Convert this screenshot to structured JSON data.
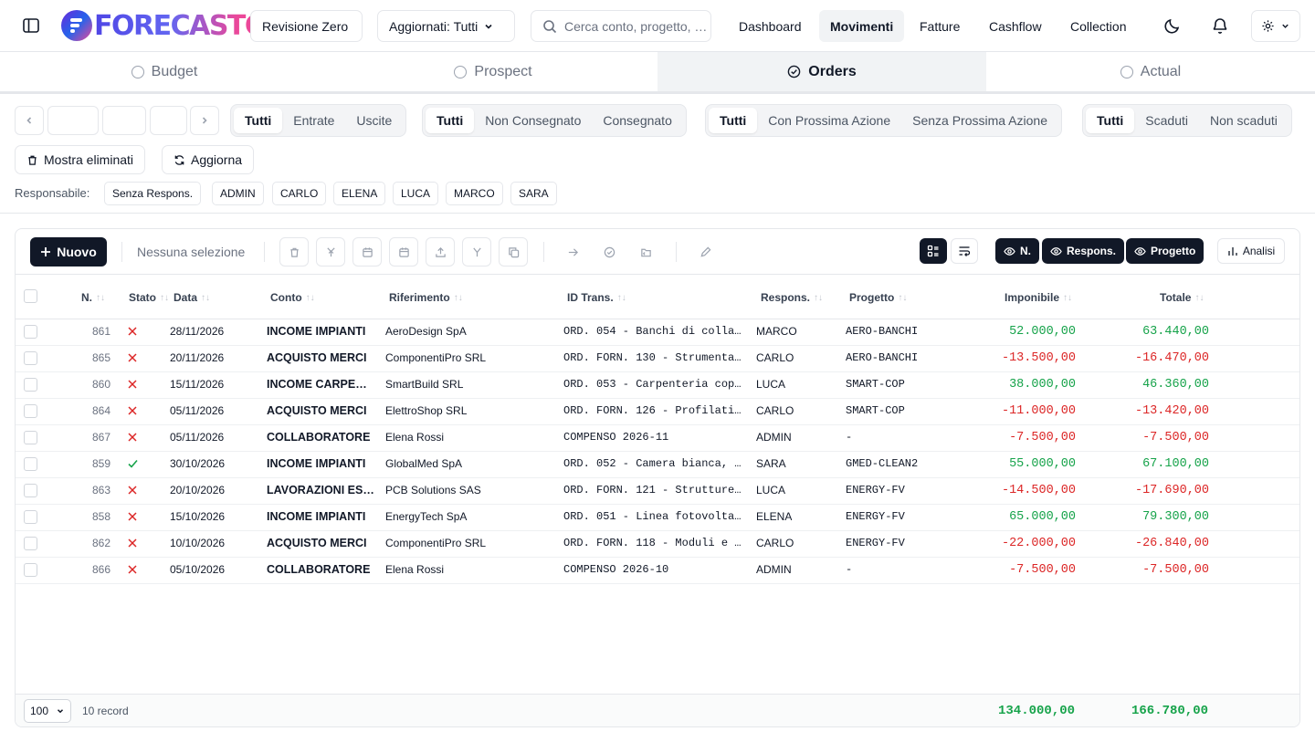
{
  "header": {
    "logo_text": "FORECASTC",
    "scenario_label": "Revisione Zero",
    "updated_label": "Aggiornati: Tutti",
    "search_placeholder": "Cerca conto, progetto, …",
    "nav": [
      "Dashboard",
      "Movimenti",
      "Fatture",
      "Cashflow",
      "Collection"
    ],
    "active_nav": "Movimenti"
  },
  "scenario_tabs": [
    {
      "label": "Budget",
      "active": false
    },
    {
      "label": "Prospect",
      "active": false
    },
    {
      "label": "Orders",
      "active": true
    },
    {
      "label": "Actual",
      "active": false
    }
  ],
  "filters": {
    "direction": [
      "Tutti",
      "Entrate",
      "Uscite"
    ],
    "delivery": [
      "Tutti",
      "Non Consegnato",
      "Consegnato"
    ],
    "next_action": [
      "Tutti",
      "Con Prossima Azione",
      "Senza Prossima Azione"
    ],
    "due": [
      "Tutti",
      "Scaduti",
      "Non scaduti"
    ]
  },
  "actions": {
    "show_deleted": "Mostra eliminati",
    "refresh": "Aggiorna"
  },
  "responsabile": {
    "label": "Responsabile:",
    "chips": [
      "Senza Respons.",
      "ADMIN",
      "CARLO",
      "ELENA",
      "LUCA",
      "MARCO",
      "SARA"
    ]
  },
  "toolbar": {
    "new_label": "Nuovo",
    "selection_text": "Nessuna selezione",
    "toggles": [
      "N.",
      "Respons.",
      "Progetto"
    ],
    "analysis_label": "Analisi"
  },
  "table": {
    "columns": [
      "N.",
      "Stato",
      "Data",
      "Conto",
      "Riferimento",
      "ID Trans.",
      "Respons.",
      "Progetto",
      "Imponibile",
      "Totale"
    ],
    "rows": [
      {
        "n": "861",
        "ok": false,
        "data": "28/11/2026",
        "conto": "INCOME IMPIANTI",
        "rif": "AeroDesign SpA",
        "id": "ORD. 054 - Banchi di colla…",
        "resp": "MARCO",
        "prog": "AERO-BANCHI",
        "imp": "52.000,00",
        "tot": "63.440,00",
        "sign": "pos"
      },
      {
        "n": "865",
        "ok": false,
        "data": "20/11/2026",
        "conto": "ACQUISTO MERCI",
        "rif": "ComponentiPro SRL",
        "id": "ORD. FORN. 130 - Strumenta…",
        "resp": "CARLO",
        "prog": "AERO-BANCHI",
        "imp": "-13.500,00",
        "tot": "-16.470,00",
        "sign": "neg"
      },
      {
        "n": "860",
        "ok": false,
        "data": "15/11/2026",
        "conto": "INCOME CARPENT…",
        "rif": "SmartBuild SRL",
        "id": "ORD. 053 - Carpenteria cop…",
        "resp": "LUCA",
        "prog": "SMART-COP",
        "imp": "38.000,00",
        "tot": "46.360,00",
        "sign": "pos"
      },
      {
        "n": "864",
        "ok": false,
        "data": "05/11/2026",
        "conto": "ACQUISTO MERCI",
        "rif": "ElettroShop SRL",
        "id": "ORD. FORN. 126 - Profilati…",
        "resp": "CARLO",
        "prog": "SMART-COP",
        "imp": "-11.000,00",
        "tot": "-13.420,00",
        "sign": "neg"
      },
      {
        "n": "867",
        "ok": false,
        "data": "05/11/2026",
        "conto": "COLLABORATORE",
        "rif": "Elena Rossi",
        "id": "COMPENSO 2026-11",
        "resp": "ADMIN",
        "prog": "-",
        "imp": "-7.500,00",
        "tot": "-7.500,00",
        "sign": "neg"
      },
      {
        "n": "859",
        "ok": true,
        "data": "30/10/2026",
        "conto": "INCOME IMPIANTI",
        "rif": "GlobalMed SpA",
        "id": "ORD. 052 - Camera bianca, …",
        "resp": "SARA",
        "prog": "GMED-CLEAN2",
        "imp": "55.000,00",
        "tot": "67.100,00",
        "sign": "pos"
      },
      {
        "n": "863",
        "ok": false,
        "data": "20/10/2026",
        "conto": "LAVORAZIONI EST…",
        "rif": "PCB Solutions SAS",
        "id": "ORD. FORN. 121 - Strutture…",
        "resp": "LUCA",
        "prog": "ENERGY-FV",
        "imp": "-14.500,00",
        "tot": "-17.690,00",
        "sign": "neg"
      },
      {
        "n": "858",
        "ok": false,
        "data": "15/10/2026",
        "conto": "INCOME IMPIANTI",
        "rif": "EnergyTech SpA",
        "id": "ORD. 051 - Linea fotovolta…",
        "resp": "ELENA",
        "prog": "ENERGY-FV",
        "imp": "65.000,00",
        "tot": "79.300,00",
        "sign": "pos"
      },
      {
        "n": "862",
        "ok": false,
        "data": "10/10/2026",
        "conto": "ACQUISTO MERCI",
        "rif": "ComponentiPro SRL",
        "id": "ORD. FORN. 118 - Moduli e …",
        "resp": "CARLO",
        "prog": "ENERGY-FV",
        "imp": "-22.000,00",
        "tot": "-26.840,00",
        "sign": "neg"
      },
      {
        "n": "866",
        "ok": false,
        "data": "05/10/2026",
        "conto": "COLLABORATORE",
        "rif": "Elena Rossi",
        "id": "COMPENSO 2026-10",
        "resp": "ADMIN",
        "prog": "-",
        "imp": "-7.500,00",
        "tot": "-7.500,00",
        "sign": "neg"
      }
    ]
  },
  "footer": {
    "page_size": "100",
    "record_count": "10 record",
    "total_imponibile": "134.000,00",
    "total_totale": "166.780,00"
  },
  "colors": {
    "positive": "#16a34a",
    "negative": "#dc2626",
    "dark": "#111827"
  }
}
